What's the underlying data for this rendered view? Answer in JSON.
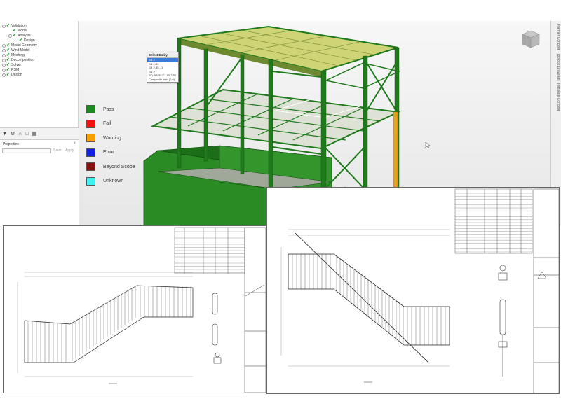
{
  "tree": {
    "items": [
      {
        "label": "Validation",
        "level": 0,
        "toggle": "-"
      },
      {
        "label": "Model",
        "level": 1
      },
      {
        "label": "Analysis",
        "level": 1,
        "toggle": "+"
      },
      {
        "label": "Design",
        "level": 2
      },
      {
        "label": "Model Geometry",
        "level": 0,
        "toggle": "+"
      },
      {
        "label": "Wind Model",
        "level": 0,
        "toggle": "+"
      },
      {
        "label": "Meshing",
        "level": 0,
        "toggle": "+"
      },
      {
        "label": "Decomposition",
        "level": 0,
        "toggle": "+"
      },
      {
        "label": "Solver",
        "level": 0,
        "toggle": "+"
      },
      {
        "label": "RSM",
        "level": 0,
        "toggle": "+"
      },
      {
        "label": "Design",
        "level": 0,
        "toggle": "+"
      }
    ]
  },
  "toolbar": {
    "icons": [
      "filter-icon",
      "gear-icon",
      "magnet-icon",
      "lock-icon",
      "table-icon"
    ]
  },
  "properties": {
    "title": "Properties",
    "close": "×",
    "save_label": "Save",
    "apply_label": "Apply"
  },
  "legend": {
    "items": [
      {
        "label": "Pass",
        "color": "#1a8a20"
      },
      {
        "label": "Fail",
        "color": "#f01010"
      },
      {
        "label": "Warning",
        "color": "#f5a000"
      },
      {
        "label": "Error",
        "color": "#1020e0"
      },
      {
        "label": "Beyond Scope",
        "color": "#8a1010"
      },
      {
        "label": "Unknown",
        "color": "#40f0f0"
      }
    ]
  },
  "select_entity": {
    "title": "Select Entity",
    "items": [
      {
        "label": "SB 2",
        "selected": true
      },
      {
        "label": "SB 2-85",
        "selected": false
      },
      {
        "label": "SB 2-85 - 1",
        "selected": false
      },
      {
        "label": "SB 2",
        "selected": false
      },
      {
        "label": "BO PREF 0\"1 50-2.50",
        "selected": false
      },
      {
        "label": "Composite slab (0.0)",
        "selected": false
      }
    ]
  },
  "right_tabs": [
    "Planner Concept",
    "Toolbox Drawings",
    "Template Concept"
  ],
  "colors": {
    "steel_green": "#1f7a1c",
    "deck_yellow": "#c8cf60",
    "accent_orange": "#e8a020"
  }
}
